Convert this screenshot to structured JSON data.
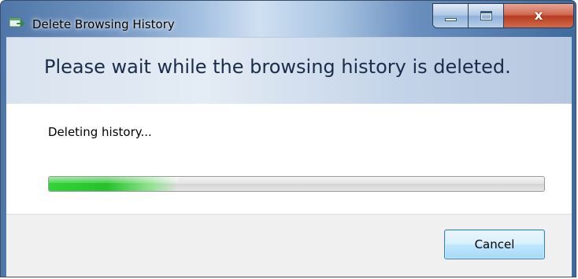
{
  "window": {
    "title": "Delete Browsing History",
    "icon": "browsing-history-icon",
    "caption_buttons": {
      "minimize": "minimize-icon",
      "maximize": "maximize-icon",
      "close": "close-icon",
      "close_glyph": "x"
    }
  },
  "header": {
    "message": "Please wait while the browsing history is deleted."
  },
  "status": {
    "text": "Deleting history..."
  },
  "progress": {
    "value_fraction": 0.26,
    "color": "#2ec234"
  },
  "buttons": {
    "cancel_label": "Cancel"
  }
}
